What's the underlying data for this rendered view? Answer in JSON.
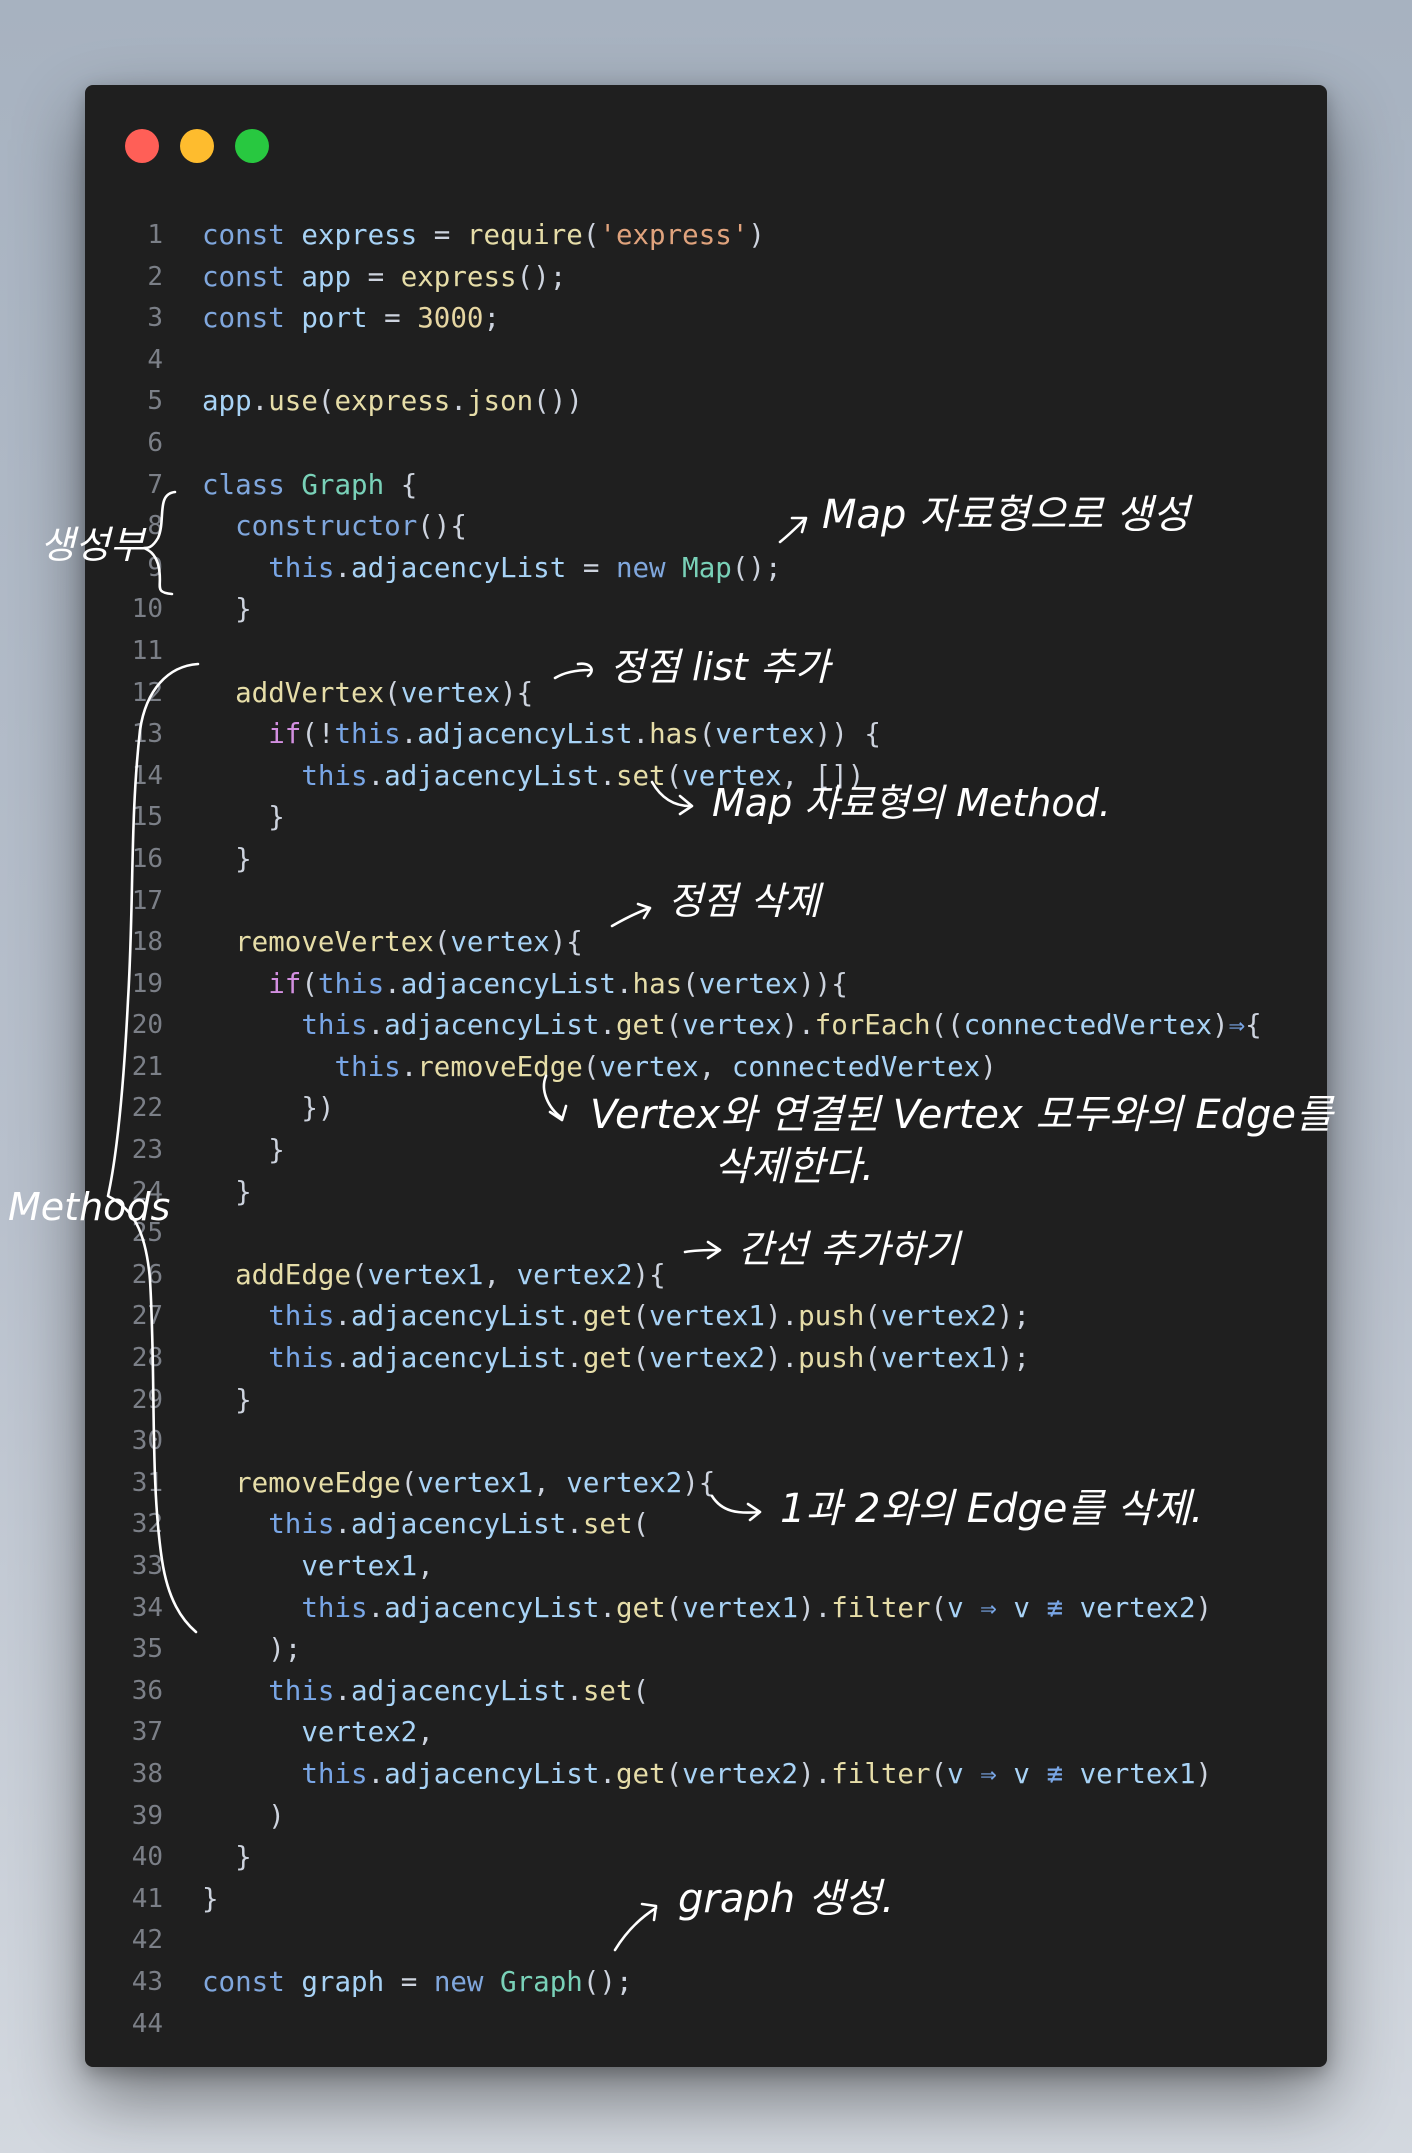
{
  "window": {
    "buttons": {
      "close": "#ff5f57",
      "minimize": "#febc2e",
      "zoom": "#28c840"
    }
  },
  "code_lines": [
    [
      [
        "kw",
        "const "
      ],
      [
        "id",
        "express"
      ],
      [
        "pu",
        " = "
      ],
      [
        "fn",
        "require"
      ],
      [
        "pu",
        "("
      ],
      [
        "str",
        "'express'"
      ],
      [
        "pu",
        ")"
      ]
    ],
    [
      [
        "kw",
        "const "
      ],
      [
        "id",
        "app"
      ],
      [
        "pu",
        " = "
      ],
      [
        "fn",
        "express"
      ],
      [
        "pu",
        "();"
      ]
    ],
    [
      [
        "kw",
        "const "
      ],
      [
        "id",
        "port"
      ],
      [
        "pu",
        " = "
      ],
      [
        "num",
        "3000"
      ],
      [
        "pu",
        ";"
      ]
    ],
    [],
    [
      [
        "id",
        "app"
      ],
      [
        "pu",
        "."
      ],
      [
        "fn",
        "use"
      ],
      [
        "pu",
        "("
      ],
      [
        "fn",
        "express"
      ],
      [
        "pu",
        "."
      ],
      [
        "fn",
        "json"
      ],
      [
        "pu",
        "())"
      ]
    ],
    [],
    [
      [
        "kw",
        "class "
      ],
      [
        "cls",
        "Graph"
      ],
      [
        "pu",
        " {"
      ]
    ],
    [
      [
        "pu",
        "  "
      ],
      [
        "kw",
        "constructor"
      ],
      [
        "pu",
        "(){"
      ]
    ],
    [
      [
        "pu",
        "    "
      ],
      [
        "th",
        "this"
      ],
      [
        "pu",
        "."
      ],
      [
        "id",
        "adjacencyList"
      ],
      [
        "pu",
        " = "
      ],
      [
        "kw",
        "new "
      ],
      [
        "cls",
        "Map"
      ],
      [
        "pu",
        "();"
      ]
    ],
    [
      [
        "pu",
        "  }"
      ]
    ],
    [],
    [
      [
        "pu",
        "  "
      ],
      [
        "fn",
        "addVertex"
      ],
      [
        "pu",
        "("
      ],
      [
        "id",
        "vertex"
      ],
      [
        "pu",
        "){"
      ]
    ],
    [
      [
        "pu",
        "    "
      ],
      [
        "ctl",
        "if"
      ],
      [
        "pu",
        "(!"
      ],
      [
        "th",
        "this"
      ],
      [
        "pu",
        "."
      ],
      [
        "id",
        "adjacencyList"
      ],
      [
        "pu",
        "."
      ],
      [
        "fn",
        "has"
      ],
      [
        "pu",
        "("
      ],
      [
        "id",
        "vertex"
      ],
      [
        "pu",
        ")) {"
      ]
    ],
    [
      [
        "pu",
        "      "
      ],
      [
        "th",
        "this"
      ],
      [
        "pu",
        "."
      ],
      [
        "id",
        "adjacencyList"
      ],
      [
        "pu",
        "."
      ],
      [
        "fn",
        "set"
      ],
      [
        "pu",
        "("
      ],
      [
        "id",
        "vertex"
      ],
      [
        "pu",
        ", [])"
      ]
    ],
    [
      [
        "pu",
        "    }"
      ]
    ],
    [
      [
        "pu",
        "  }"
      ]
    ],
    [],
    [
      [
        "pu",
        "  "
      ],
      [
        "fn",
        "removeVertex"
      ],
      [
        "pu",
        "("
      ],
      [
        "id",
        "vertex"
      ],
      [
        "pu",
        "){"
      ]
    ],
    [
      [
        "pu",
        "    "
      ],
      [
        "ctl",
        "if"
      ],
      [
        "pu",
        "("
      ],
      [
        "th",
        "this"
      ],
      [
        "pu",
        "."
      ],
      [
        "id",
        "adjacencyList"
      ],
      [
        "pu",
        "."
      ],
      [
        "fn",
        "has"
      ],
      [
        "pu",
        "("
      ],
      [
        "id",
        "vertex"
      ],
      [
        "pu",
        ")){"
      ]
    ],
    [
      [
        "pu",
        "      "
      ],
      [
        "th",
        "this"
      ],
      [
        "pu",
        "."
      ],
      [
        "id",
        "adjacencyList"
      ],
      [
        "pu",
        "."
      ],
      [
        "fn",
        "get"
      ],
      [
        "pu",
        "("
      ],
      [
        "id",
        "vertex"
      ],
      [
        "pu",
        ")."
      ],
      [
        "fn",
        "forEach"
      ],
      [
        "pu",
        "(("
      ],
      [
        "id",
        "connectedVertex"
      ],
      [
        "pu",
        ")"
      ],
      [
        "arr",
        "⇒"
      ],
      [
        "pu",
        "{"
      ]
    ],
    [
      [
        "pu",
        "        "
      ],
      [
        "th",
        "this"
      ],
      [
        "pu",
        "."
      ],
      [
        "fn",
        "removeEdge"
      ],
      [
        "pu",
        "("
      ],
      [
        "id",
        "vertex"
      ],
      [
        "pu",
        ", "
      ],
      [
        "id",
        "connectedVertex"
      ],
      [
        "pu",
        ")"
      ]
    ],
    [
      [
        "pu",
        "      })"
      ]
    ],
    [
      [
        "pu",
        "    }"
      ]
    ],
    [
      [
        "pu",
        "  }"
      ]
    ],
    [],
    [
      [
        "pu",
        "  "
      ],
      [
        "fn",
        "addEdge"
      ],
      [
        "pu",
        "("
      ],
      [
        "id",
        "vertex1"
      ],
      [
        "pu",
        ", "
      ],
      [
        "id",
        "vertex2"
      ],
      [
        "pu",
        "){"
      ]
    ],
    [
      [
        "pu",
        "    "
      ],
      [
        "th",
        "this"
      ],
      [
        "pu",
        "."
      ],
      [
        "id",
        "adjacencyList"
      ],
      [
        "pu",
        "."
      ],
      [
        "fn",
        "get"
      ],
      [
        "pu",
        "("
      ],
      [
        "id",
        "vertex1"
      ],
      [
        "pu",
        ")."
      ],
      [
        "fn",
        "push"
      ],
      [
        "pu",
        "("
      ],
      [
        "id",
        "vertex2"
      ],
      [
        "pu",
        ");"
      ]
    ],
    [
      [
        "pu",
        "    "
      ],
      [
        "th",
        "this"
      ],
      [
        "pu",
        "."
      ],
      [
        "id",
        "adjacencyList"
      ],
      [
        "pu",
        "."
      ],
      [
        "fn",
        "get"
      ],
      [
        "pu",
        "("
      ],
      [
        "id",
        "vertex2"
      ],
      [
        "pu",
        ")."
      ],
      [
        "fn",
        "push"
      ],
      [
        "pu",
        "("
      ],
      [
        "id",
        "vertex1"
      ],
      [
        "pu",
        ");"
      ]
    ],
    [
      [
        "pu",
        "  }"
      ]
    ],
    [],
    [
      [
        "pu",
        "  "
      ],
      [
        "fn",
        "removeEdge"
      ],
      [
        "pu",
        "("
      ],
      [
        "id",
        "vertex1"
      ],
      [
        "pu",
        ", "
      ],
      [
        "id",
        "vertex2"
      ],
      [
        "pu",
        "){"
      ]
    ],
    [
      [
        "pu",
        "    "
      ],
      [
        "th",
        "this"
      ],
      [
        "pu",
        "."
      ],
      [
        "id",
        "adjacencyList"
      ],
      [
        "pu",
        "."
      ],
      [
        "fn",
        "set"
      ],
      [
        "pu",
        "("
      ]
    ],
    [
      [
        "pu",
        "      "
      ],
      [
        "id",
        "vertex1"
      ],
      [
        "pu",
        ","
      ]
    ],
    [
      [
        "pu",
        "      "
      ],
      [
        "th",
        "this"
      ],
      [
        "pu",
        "."
      ],
      [
        "id",
        "adjacencyList"
      ],
      [
        "pu",
        "."
      ],
      [
        "fn",
        "get"
      ],
      [
        "pu",
        "("
      ],
      [
        "id",
        "vertex1"
      ],
      [
        "pu",
        ")."
      ],
      [
        "fn",
        "filter"
      ],
      [
        "pu",
        "("
      ],
      [
        "id",
        "v"
      ],
      [
        "pu",
        " "
      ],
      [
        "arr",
        "⇒"
      ],
      [
        "pu",
        " "
      ],
      [
        "id",
        "v"
      ],
      [
        "pu",
        " "
      ],
      [
        "arr",
        "≢"
      ],
      [
        "pu",
        " "
      ],
      [
        "id",
        "vertex2"
      ],
      [
        "pu",
        ")"
      ]
    ],
    [
      [
        "pu",
        "    );"
      ]
    ],
    [
      [
        "pu",
        "    "
      ],
      [
        "th",
        "this"
      ],
      [
        "pu",
        "."
      ],
      [
        "id",
        "adjacencyList"
      ],
      [
        "pu",
        "."
      ],
      [
        "fn",
        "set"
      ],
      [
        "pu",
        "("
      ]
    ],
    [
      [
        "pu",
        "      "
      ],
      [
        "id",
        "vertex2"
      ],
      [
        "pu",
        ","
      ]
    ],
    [
      [
        "pu",
        "      "
      ],
      [
        "th",
        "this"
      ],
      [
        "pu",
        "."
      ],
      [
        "id",
        "adjacencyList"
      ],
      [
        "pu",
        "."
      ],
      [
        "fn",
        "get"
      ],
      [
        "pu",
        "("
      ],
      [
        "id",
        "vertex2"
      ],
      [
        "pu",
        ")."
      ],
      [
        "fn",
        "filter"
      ],
      [
        "pu",
        "("
      ],
      [
        "id",
        "v"
      ],
      [
        "pu",
        " "
      ],
      [
        "arr",
        "⇒"
      ],
      [
        "pu",
        " "
      ],
      [
        "id",
        "v"
      ],
      [
        "pu",
        " "
      ],
      [
        "arr",
        "≢"
      ],
      [
        "pu",
        " "
      ],
      [
        "id",
        "vertex1"
      ],
      [
        "pu",
        ")"
      ]
    ],
    [
      [
        "pu",
        "    )"
      ]
    ],
    [
      [
        "pu",
        "  }"
      ]
    ],
    [
      [
        "pu",
        "}"
      ]
    ],
    [],
    [
      [
        "kw",
        "const "
      ],
      [
        "id",
        "graph"
      ],
      [
        "pu",
        " = "
      ],
      [
        "kw",
        "new "
      ],
      [
        "cls",
        "Graph"
      ],
      [
        "pu",
        "();"
      ]
    ],
    []
  ],
  "annotations": {
    "constructor_section": "생성부",
    "map_type": "Map 자료형으로 생성",
    "add_vertex": "정점 list 추가",
    "map_method": "Map 자료형의 Method.",
    "remove_vertex": "정점 삭제",
    "remove_edges_line1": "Vertex와 연결된 Vertex 모두와의 Edge를",
    "remove_edges_line2": "삭제한다.",
    "methods_section": "Methods",
    "add_edge": "간선 추가하기",
    "remove_edge": "1과 2와의 Edge를 삭제.",
    "graph_create": "graph 생성."
  }
}
